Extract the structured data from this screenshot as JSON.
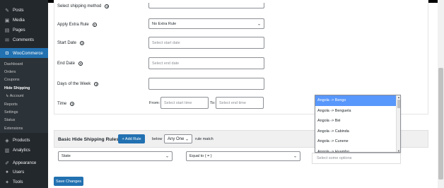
{
  "sidebar": {
    "items": [
      {
        "icon": "pushpin-icon",
        "glyph": "✎",
        "label": "Posts"
      },
      {
        "icon": "media-icon",
        "glyph": "▣",
        "label": "Media"
      },
      {
        "icon": "pages-icon",
        "glyph": "▤",
        "label": "Pages"
      },
      {
        "icon": "comments-icon",
        "glyph": "✉",
        "label": "Comments"
      },
      {
        "icon": "woocommerce-icon",
        "glyph": "◘",
        "label": "WooCommerce"
      }
    ],
    "submenu": [
      {
        "label": "Dashboard"
      },
      {
        "label": "Orders"
      },
      {
        "label": "Coupons"
      },
      {
        "label": "Hide Shipping"
      },
      {
        "label": "↳ Account"
      },
      {
        "label": "Reports"
      },
      {
        "label": "Settings"
      },
      {
        "label": "Status"
      },
      {
        "label": "Extensions"
      }
    ],
    "bottom_items": [
      {
        "icon": "products-icon",
        "glyph": "◈",
        "label": "Products"
      },
      {
        "icon": "analytics-icon",
        "glyph": "▥",
        "label": "Analytics"
      },
      {
        "icon": "appearance-icon",
        "glyph": "✐",
        "label": "Appearance"
      },
      {
        "icon": "users-icon",
        "glyph": "●",
        "label": "Users"
      },
      {
        "icon": "tools-icon",
        "glyph": "✦",
        "label": "Tools"
      }
    ],
    "colors": {
      "bg": "#23282d",
      "active": "#2271b1"
    }
  },
  "form": {
    "select_shipping_method_label": "Select shipping method",
    "apply_extra_rule_label": "Apply Extra Rule",
    "apply_extra_rule_value": "No Extra Rule",
    "start_date_label": "Start Date",
    "start_date_placeholder": "Select start date",
    "end_date_label": "End Date",
    "end_date_placeholder": "Select end date",
    "days_of_week_label": "Days of the Week",
    "time_label": "Time",
    "time_from_label": "From:",
    "time_from_placeholder": "Select start time",
    "time_to_label": "To:",
    "time_to_placeholder": "Select end time"
  },
  "rules": {
    "title": "Basic Hide Shipping Rules",
    "add_rule_label": "+ Add Rule",
    "below_label": "below",
    "match_value": "Any One",
    "match_suffix": "rule match",
    "condition_field": "State",
    "condition_operator": "Equal to ( = )",
    "values_placeholder": "Select some options"
  },
  "dropdown": {
    "options": [
      "Angola -> Bengo",
      "Angola -> Benguela",
      "Angola -> Bié",
      "Angola -> Cabinda",
      "Angola -> Cunene",
      "Angola -> Huambo"
    ],
    "highlighted_index": 0
  },
  "save_label": "Save Changes"
}
